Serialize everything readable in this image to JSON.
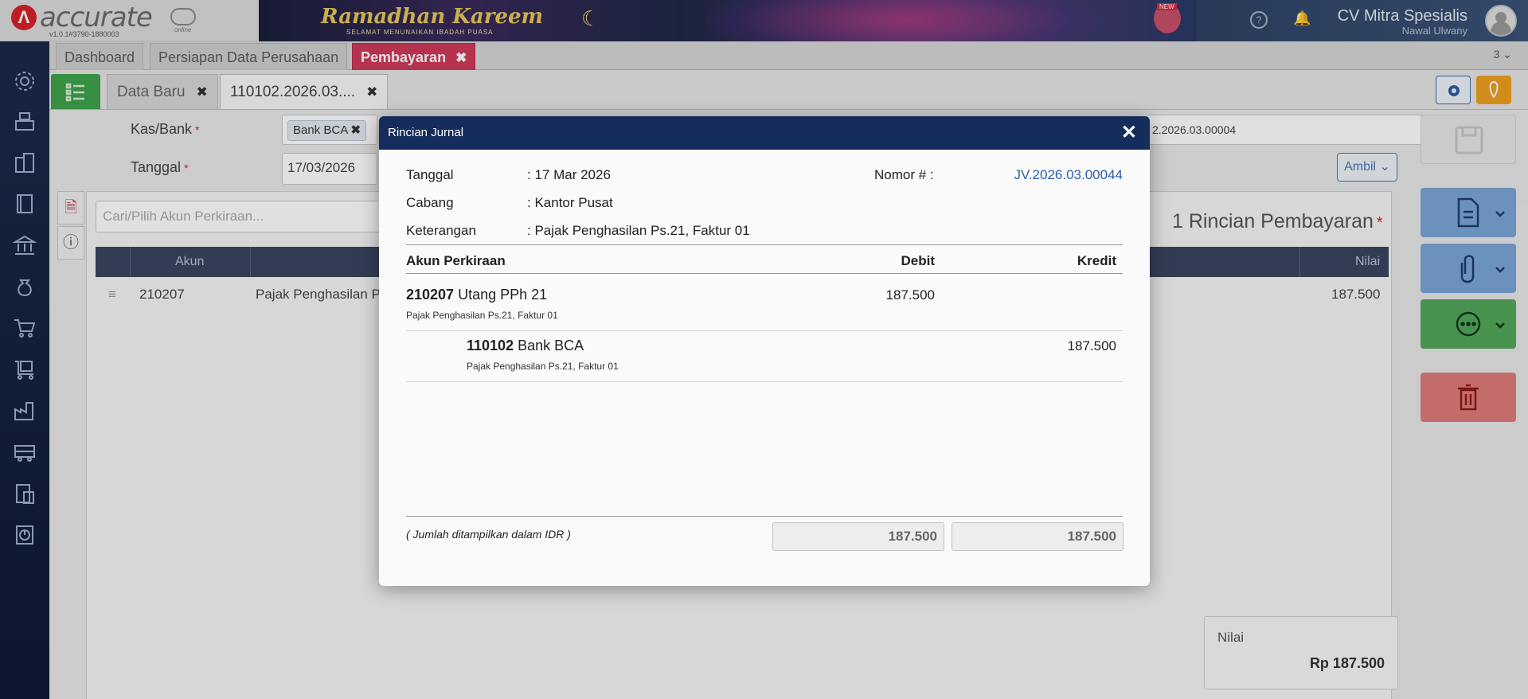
{
  "header": {
    "app_name": "accurate",
    "app_edition": "online",
    "version": "v1.0.1#3790-1880003",
    "banner_title": "Ramadhan Kareem",
    "banner_subtitle": "SELAMAT MENUNAIKAN IBADAH PUASA",
    "banner_badge": "NEW",
    "company": "CV Mitra Spesialis",
    "user": "Nawal Ulwany"
  },
  "module_tabs": [
    {
      "label": "Dashboard"
    },
    {
      "label": "Persiapan Data Perusahaan"
    },
    {
      "label": "Pembayaran",
      "active": true
    }
  ],
  "module_tab_count": "3",
  "doc_tabs": [
    {
      "label": "Data Baru"
    },
    {
      "label": "110102.2026.03....",
      "active": true
    }
  ],
  "form": {
    "kas_bank_label": "Kas/Bank",
    "kas_bank_value": "Bank BCA",
    "tanggal_label": "Tanggal",
    "tanggal_value": "17/03/2026",
    "nomor_partial": "2.2026.03.00004",
    "ambil_label": "Ambil",
    "search_placeholder": "Cari/Pilih Akun Perkiraan...",
    "rincian_title": "1 Rincian Pembayaran",
    "table_headers": {
      "akun": "Akun",
      "nilai": "Nilai"
    },
    "row": {
      "akun": "210207",
      "nama": "Pajak Penghasilan P",
      "nilai": "187.500"
    },
    "nilai_label": "Nilai",
    "nilai_value": "Rp 187.500"
  },
  "modal": {
    "title": "Rincian Jurnal",
    "tanggal_label": "Tanggal",
    "tanggal_value": ": 17 Mar 2026",
    "cabang_label": "Cabang",
    "cabang_value": ": Kantor Pusat",
    "keterangan_label": "Keterangan",
    "keterangan_value": ": Pajak Penghasilan Ps.21, Faktur 01",
    "nomor_label": "Nomor # :",
    "nomor_value": "JV.2026.03.00044",
    "col_akun": "Akun Perkiraan",
    "col_debit": "Debit",
    "col_kredit": "Kredit",
    "entries": [
      {
        "code": "210207",
        "name": "Utang PPh 21",
        "desc": "Pajak Penghasilan Ps.21, Faktur 01",
        "debit": "187.500",
        "kredit": ""
      },
      {
        "code": "110102",
        "name": "Bank BCA",
        "desc": "Pajak Penghasilan Ps.21, Faktur 01",
        "debit": "",
        "kredit": "187.500"
      }
    ],
    "currency_note": "( Jumlah ditampilkan dalam IDR )",
    "total_debit": "187.500",
    "total_kredit": "187.500"
  },
  "colors": {
    "modal_header": "#152d5a",
    "active_tab": "#d03b5b",
    "nomor_link": "#2a5fae"
  }
}
